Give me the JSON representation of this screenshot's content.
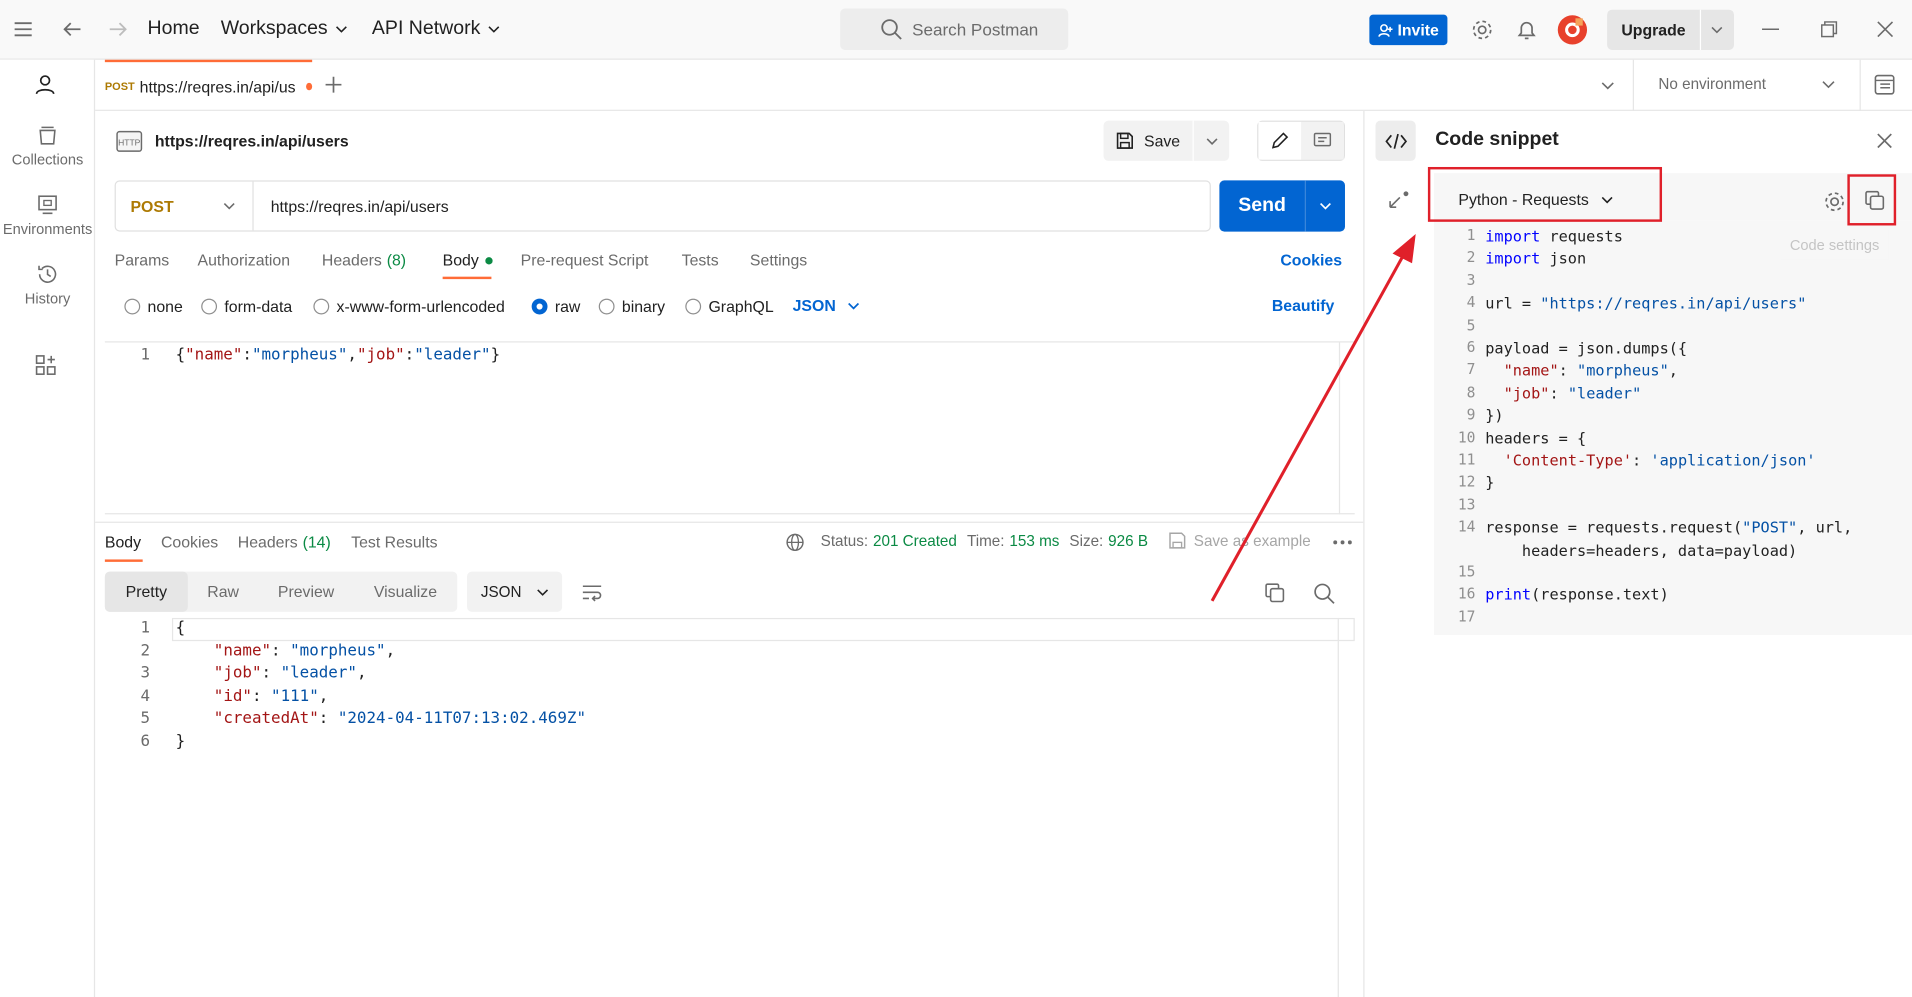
{
  "topbar": {
    "home": "Home",
    "workspaces": "Workspaces",
    "api_network": "API Network",
    "search_placeholder": "Search Postman",
    "invite": "Invite",
    "upgrade": "Upgrade"
  },
  "sidebar": {
    "items": [
      {
        "label": "Collections",
        "icon": "collections-icon"
      },
      {
        "label": "Environments",
        "icon": "environments-icon"
      },
      {
        "label": "History",
        "icon": "history-icon"
      }
    ]
  },
  "tab": {
    "method": "POST",
    "title": "https://reqres.in/api/us"
  },
  "environment": "No environment",
  "request": {
    "icon_label": "HTTP",
    "name": "https://reqres.in/api/users",
    "save": "Save",
    "method": "POST",
    "url": "https://reqres.in/api/users",
    "send": "Send",
    "tabs": [
      "Params",
      "Authorization",
      "Headers",
      "Body",
      "Pre-request Script",
      "Tests",
      "Settings"
    ],
    "headers_count": "(8)",
    "cookies": "Cookies",
    "body_types": [
      "none",
      "form-data",
      "x-www-form-urlencoded",
      "raw",
      "binary",
      "GraphQL"
    ],
    "body_format": "JSON",
    "beautify": "Beautify",
    "body_line_no": "1",
    "body_tokens": [
      "{",
      "\"name\"",
      ":",
      "\"morpheus\"",
      ",",
      "\"job\"",
      ":",
      "\"leader\"",
      "}"
    ]
  },
  "response": {
    "tabs": [
      "Body",
      "Cookies",
      "Headers",
      "Test Results"
    ],
    "headers_count": "(14)",
    "status_label": "Status:",
    "status_value": "201 Created",
    "time_label": "Time:",
    "time_value": "153 ms",
    "size_label": "Size:",
    "size_value": "926 B",
    "save_example": "Save as example",
    "view_modes": [
      "Pretty",
      "Raw",
      "Preview",
      "Visualize"
    ],
    "format": "JSON",
    "lines": [
      {
        "n": "1",
        "parts": [
          {
            "t": "{",
            "c": ""
          }
        ]
      },
      {
        "n": "2",
        "parts": [
          {
            "t": "    ",
            "c": ""
          },
          {
            "t": "\"name\"",
            "c": "key"
          },
          {
            "t": ": ",
            "c": ""
          },
          {
            "t": "\"morpheus\"",
            "c": "str"
          },
          {
            "t": ",",
            "c": ""
          }
        ]
      },
      {
        "n": "3",
        "parts": [
          {
            "t": "    ",
            "c": ""
          },
          {
            "t": "\"job\"",
            "c": "key"
          },
          {
            "t": ": ",
            "c": ""
          },
          {
            "t": "\"leader\"",
            "c": "str"
          },
          {
            "t": ",",
            "c": ""
          }
        ]
      },
      {
        "n": "4",
        "parts": [
          {
            "t": "    ",
            "c": ""
          },
          {
            "t": "\"id\"",
            "c": "key"
          },
          {
            "t": ": ",
            "c": ""
          },
          {
            "t": "\"111\"",
            "c": "str"
          },
          {
            "t": ",",
            "c": ""
          }
        ]
      },
      {
        "n": "5",
        "parts": [
          {
            "t": "    ",
            "c": ""
          },
          {
            "t": "\"createdAt\"",
            "c": "key"
          },
          {
            "t": ": ",
            "c": ""
          },
          {
            "t": "\"2024-04-11T07:13:02.469Z\"",
            "c": "str"
          }
        ]
      },
      {
        "n": "6",
        "parts": [
          {
            "t": "}",
            "c": ""
          }
        ]
      }
    ]
  },
  "snippet": {
    "title": "Code snippet",
    "language": "Python - Requests",
    "tooltip": "Code settings",
    "lines": [
      {
        "n": "1",
        "parts": [
          {
            "t": "import",
            "c": "kw"
          },
          {
            "t": " requests",
            "c": ""
          }
        ]
      },
      {
        "n": "2",
        "parts": [
          {
            "t": "import",
            "c": "kw"
          },
          {
            "t": " json",
            "c": ""
          }
        ]
      },
      {
        "n": "3",
        "parts": []
      },
      {
        "n": "4",
        "parts": [
          {
            "t": "url = ",
            "c": ""
          },
          {
            "t": "\"https://reqres.in/api/users\"",
            "c": "str"
          }
        ]
      },
      {
        "n": "5",
        "parts": []
      },
      {
        "n": "6",
        "parts": [
          {
            "t": "payload = json.dumps({",
            "c": ""
          }
        ]
      },
      {
        "n": "7",
        "parts": [
          {
            "t": "  ",
            "c": ""
          },
          {
            "t": "\"name\"",
            "c": "key"
          },
          {
            "t": ": ",
            "c": ""
          },
          {
            "t": "\"morpheus\"",
            "c": "str"
          },
          {
            "t": ",",
            "c": ""
          }
        ]
      },
      {
        "n": "8",
        "parts": [
          {
            "t": "  ",
            "c": ""
          },
          {
            "t": "\"job\"",
            "c": "key"
          },
          {
            "t": ": ",
            "c": ""
          },
          {
            "t": "\"leader\"",
            "c": "str"
          }
        ]
      },
      {
        "n": "9",
        "parts": [
          {
            "t": "})",
            "c": ""
          }
        ]
      },
      {
        "n": "10",
        "parts": [
          {
            "t": "headers = {",
            "c": ""
          }
        ]
      },
      {
        "n": "11",
        "parts": [
          {
            "t": "  ",
            "c": ""
          },
          {
            "t": "'Content-Type'",
            "c": "key"
          },
          {
            "t": ": ",
            "c": ""
          },
          {
            "t": "'application/json'",
            "c": "str"
          }
        ]
      },
      {
        "n": "12",
        "parts": [
          {
            "t": "}",
            "c": ""
          }
        ]
      },
      {
        "n": "13",
        "parts": []
      },
      {
        "n": "14",
        "parts": [
          {
            "t": "response = requests.request(",
            "c": ""
          },
          {
            "t": "\"POST\"",
            "c": "str"
          },
          {
            "t": ", url,",
            "c": ""
          }
        ]
      },
      {
        "n": "",
        "parts": [
          {
            "t": "    headers=headers, data=payload)",
            "c": ""
          }
        ]
      },
      {
        "n": "15",
        "parts": []
      },
      {
        "n": "16",
        "parts": [
          {
            "t": "print",
            "c": "kw"
          },
          {
            "t": "(response.text)",
            "c": ""
          }
        ]
      },
      {
        "n": "17",
        "parts": []
      }
    ]
  },
  "colors": {
    "accent": "#0265d2",
    "post": "#ad7a03",
    "tab_active": "#ff6c37",
    "status_ok": "#0b8a44",
    "annotation": "#e0202a"
  }
}
